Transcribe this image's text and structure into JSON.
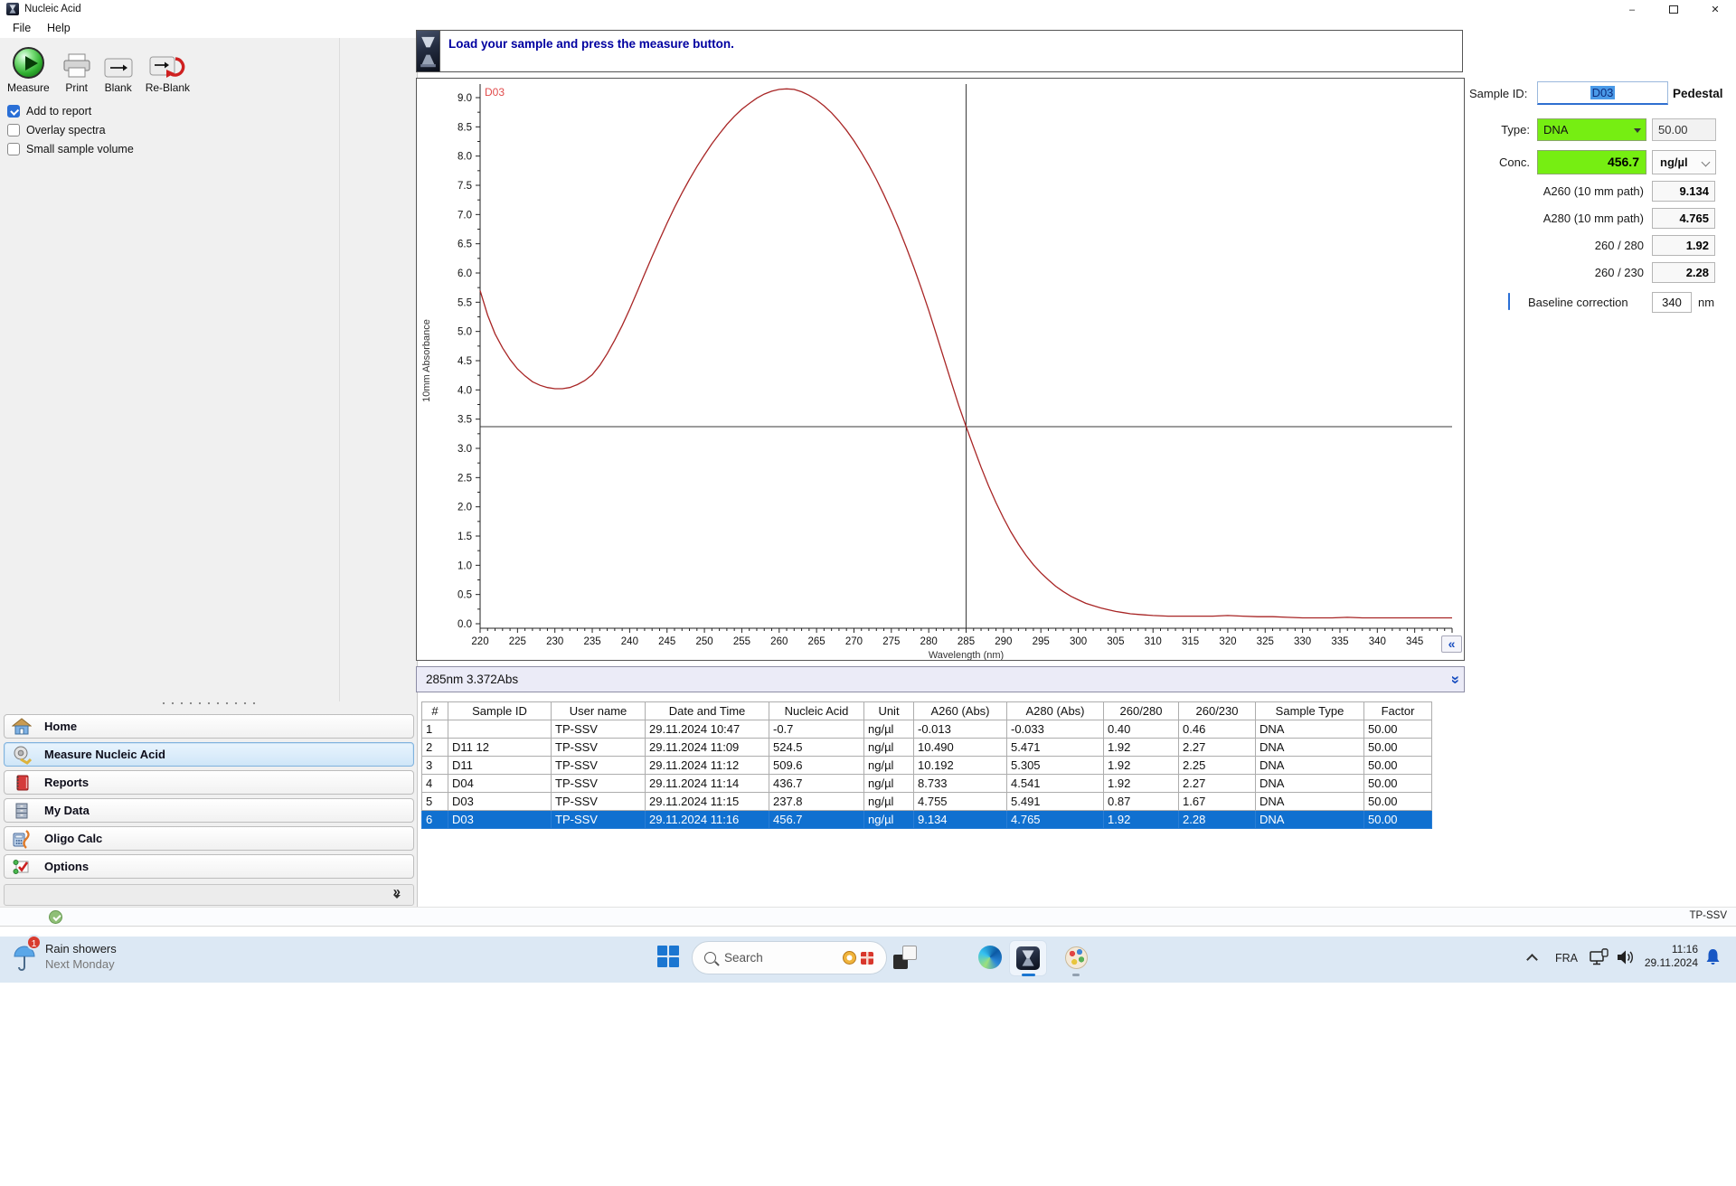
{
  "window": {
    "title": "Nucleic Acid",
    "controls": {
      "minimize": "–",
      "close": "✕"
    }
  },
  "menu": {
    "items": [
      "File",
      "Help"
    ]
  },
  "toolbar": {
    "measure": "Measure",
    "print": "Print",
    "blank": "Blank",
    "reblank": "Re-Blank"
  },
  "checkboxes": [
    {
      "label": "Add to report",
      "checked": true
    },
    {
      "label": "Overlay spectra",
      "checked": false
    },
    {
      "label": "Small sample volume",
      "checked": false
    }
  ],
  "message_bar": {
    "text": "Load your sample and press the measure button."
  },
  "chart_data": {
    "type": "line",
    "xlabel": "Wavelength (nm)",
    "ylabel": "10mm Absorbance",
    "xlim": [
      220,
      350
    ],
    "ylim": [
      0,
      9.3
    ],
    "x_major": 5,
    "x_minor": 1,
    "y_major": 0.5,
    "y_minor": 0.25,
    "y_label_max": 9.0,
    "grid": false,
    "crosshair": {
      "x": 285,
      "y": 3.372
    },
    "series": [
      {
        "name": "D03",
        "color": "#a82525",
        "points": [
          [
            220,
            5.7
          ],
          [
            221,
            5.28
          ],
          [
            222,
            4.96
          ],
          [
            223,
            4.72
          ],
          [
            224,
            4.52
          ],
          [
            225,
            4.36
          ],
          [
            226,
            4.24
          ],
          [
            227,
            4.14
          ],
          [
            228,
            4.08
          ],
          [
            229,
            4.04
          ],
          [
            230,
            4.02
          ],
          [
            231,
            4.02
          ],
          [
            232,
            4.04
          ],
          [
            233,
            4.09
          ],
          [
            234,
            4.16
          ],
          [
            235,
            4.26
          ],
          [
            236,
            4.42
          ],
          [
            237,
            4.62
          ],
          [
            238,
            4.85
          ],
          [
            239,
            5.1
          ],
          [
            240,
            5.38
          ],
          [
            241,
            5.68
          ],
          [
            242,
            5.98
          ],
          [
            243,
            6.28
          ],
          [
            244,
            6.57
          ],
          [
            245,
            6.85
          ],
          [
            246,
            7.12
          ],
          [
            247,
            7.37
          ],
          [
            248,
            7.6
          ],
          [
            249,
            7.82
          ],
          [
            250,
            8.02
          ],
          [
            251,
            8.21
          ],
          [
            252,
            8.38
          ],
          [
            253,
            8.54
          ],
          [
            254,
            8.68
          ],
          [
            255,
            8.8
          ],
          [
            256,
            8.9
          ],
          [
            257,
            8.99
          ],
          [
            258,
            9.06
          ],
          [
            259,
            9.11
          ],
          [
            260,
            9.14
          ],
          [
            261,
            9.15
          ],
          [
            262,
            9.14
          ],
          [
            263,
            9.1
          ],
          [
            264,
            9.04
          ],
          [
            265,
            8.96
          ],
          [
            266,
            8.86
          ],
          [
            267,
            8.74
          ],
          [
            268,
            8.6
          ],
          [
            269,
            8.44
          ],
          [
            270,
            8.26
          ],
          [
            271,
            8.06
          ],
          [
            272,
            7.84
          ],
          [
            273,
            7.6
          ],
          [
            274,
            7.34
          ],
          [
            275,
            7.06
          ],
          [
            276,
            6.76
          ],
          [
            277,
            6.44
          ],
          [
            278,
            6.1
          ],
          [
            279,
            5.74
          ],
          [
            280,
            5.36
          ],
          [
            281,
            4.96
          ],
          [
            282,
            4.55
          ],
          [
            283,
            4.14
          ],
          [
            284,
            3.74
          ],
          [
            285,
            3.372
          ],
          [
            286,
            3.02
          ],
          [
            287,
            2.68
          ],
          [
            288,
            2.36
          ],
          [
            289,
            2.07
          ],
          [
            290,
            1.81
          ],
          [
            291,
            1.57
          ],
          [
            292,
            1.36
          ],
          [
            293,
            1.17
          ],
          [
            294,
            1.01
          ],
          [
            295,
            0.87
          ],
          [
            296,
            0.75
          ],
          [
            297,
            0.64
          ],
          [
            298,
            0.55
          ],
          [
            299,
            0.47
          ],
          [
            300,
            0.41
          ],
          [
            301,
            0.35
          ],
          [
            302,
            0.31
          ],
          [
            303,
            0.27
          ],
          [
            304,
            0.24
          ],
          [
            305,
            0.21
          ],
          [
            306,
            0.19
          ],
          [
            307,
            0.17
          ],
          [
            308,
            0.16
          ],
          [
            309,
            0.15
          ],
          [
            310,
            0.14
          ],
          [
            312,
            0.13
          ],
          [
            314,
            0.13
          ],
          [
            316,
            0.13
          ],
          [
            318,
            0.13
          ],
          [
            320,
            0.14
          ],
          [
            322,
            0.13
          ],
          [
            324,
            0.12
          ],
          [
            326,
            0.12
          ],
          [
            328,
            0.11
          ],
          [
            330,
            0.1
          ],
          [
            332,
            0.1
          ],
          [
            334,
            0.1
          ],
          [
            336,
            0.11
          ],
          [
            338,
            0.1
          ],
          [
            340,
            0.1
          ],
          [
            342,
            0.1
          ],
          [
            344,
            0.1
          ],
          [
            346,
            0.1
          ],
          [
            348,
            0.1
          ],
          [
            350,
            0.1
          ]
        ]
      }
    ]
  },
  "chart_ui": {
    "legend_label": "D03",
    "collapse_glyph": "«",
    "expand_glyph": "»"
  },
  "cursor_bar": {
    "text": "285nm 3.372Abs"
  },
  "sample_panel": {
    "sample_id_label": "Sample ID:",
    "sample_id_value": "D03",
    "mode": "Pedestal",
    "type_label": "Type:",
    "type_value": "DNA",
    "factor_value": "50.00",
    "conc_label": "Conc.",
    "conc_value": "456.7",
    "conc_unit": "ng/µl",
    "readings": [
      {
        "label": "A260 (10 mm path)",
        "value": "9.134"
      },
      {
        "label": "A280 (10 mm path)",
        "value": "4.765"
      },
      {
        "label": "260 / 280",
        "value": "1.92"
      },
      {
        "label": "260 / 230",
        "value": "2.28"
      }
    ],
    "baseline": {
      "label": "Baseline correction",
      "checked": true,
      "value": "340",
      "unit": "nm"
    }
  },
  "results_table": {
    "columns": [
      "#",
      "Sample ID",
      "User name",
      "Date and Time",
      "Nucleic Acid",
      "Unit",
      "A260 (Abs)",
      "A280 (Abs)",
      "260/280",
      "260/230",
      "Sample Type",
      "Factor"
    ],
    "rows": [
      [
        "1",
        "",
        "TP-SSV",
        "29.11.2024 10:47",
        "-0.7",
        "ng/µl",
        "-0.013",
        "-0.033",
        "0.40",
        "0.46",
        "DNA",
        "50.00"
      ],
      [
        "2",
        "D11 12",
        "TP-SSV",
        "29.11.2024 11:09",
        "524.5",
        "ng/µl",
        "10.490",
        "5.471",
        "1.92",
        "2.27",
        "DNA",
        "50.00"
      ],
      [
        "3",
        "D11",
        "TP-SSV",
        "29.11.2024 11:12",
        "509.6",
        "ng/µl",
        "10.192",
        "5.305",
        "1.92",
        "2.25",
        "DNA",
        "50.00"
      ],
      [
        "4",
        "D04",
        "TP-SSV",
        "29.11.2024 11:14",
        "436.7",
        "ng/µl",
        "8.733",
        "4.541",
        "1.92",
        "2.27",
        "DNA",
        "50.00"
      ],
      [
        "5",
        "D03",
        "TP-SSV",
        "29.11.2024 11:15",
        "237.8",
        "ng/µl",
        "4.755",
        "5.491",
        "0.87",
        "1.67",
        "DNA",
        "50.00"
      ],
      [
        "6",
        "D03",
        "TP-SSV",
        "29.11.2024 11:16",
        "456.7",
        "ng/µl",
        "9.134",
        "4.765",
        "1.92",
        "2.28",
        "DNA",
        "50.00"
      ]
    ],
    "selected_index": 5
  },
  "sidebar": {
    "items": [
      {
        "label": "Home"
      },
      {
        "label": "Measure Nucleic Acid"
      },
      {
        "label": "Reports"
      },
      {
        "label": "My Data"
      },
      {
        "label": "Oligo Calc"
      },
      {
        "label": "Options"
      }
    ],
    "selected_index": 1
  },
  "app_status": {
    "user": "TP-SSV"
  },
  "taskbar": {
    "weather": {
      "line1": "Rain showers",
      "line2": "Next Monday",
      "badge": "1"
    },
    "search": {
      "placeholder": "Search"
    },
    "tray": {
      "language": "FRA",
      "time": "11:16",
      "date": "29.11.2024"
    }
  }
}
